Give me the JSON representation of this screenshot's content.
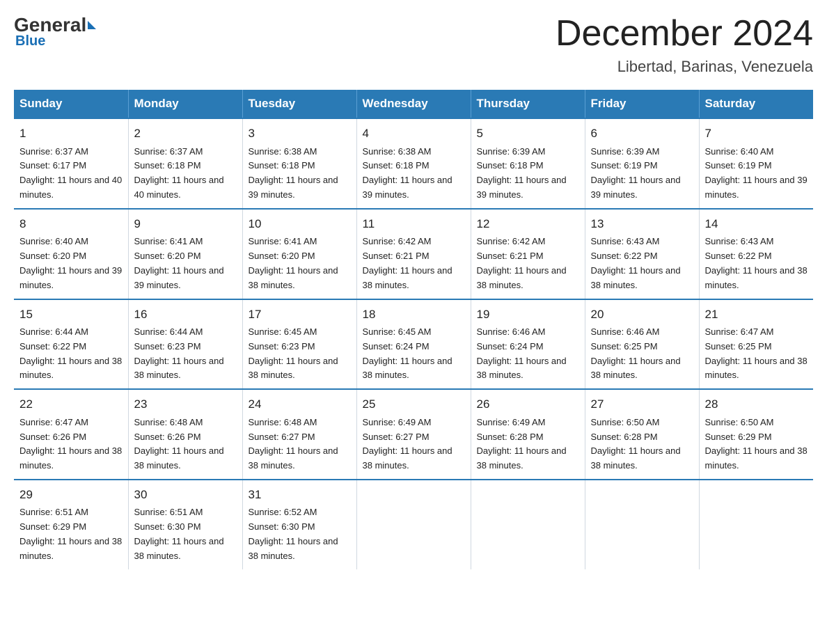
{
  "logo": {
    "general": "General",
    "blue": "Blue"
  },
  "title": "December 2024",
  "subtitle": "Libertad, Barinas, Venezuela",
  "days_of_week": [
    "Sunday",
    "Monday",
    "Tuesday",
    "Wednesday",
    "Thursday",
    "Friday",
    "Saturday"
  ],
  "weeks": [
    [
      {
        "day": "1",
        "sunrise": "6:37 AM",
        "sunset": "6:17 PM",
        "daylight": "11 hours and 40 minutes."
      },
      {
        "day": "2",
        "sunrise": "6:37 AM",
        "sunset": "6:18 PM",
        "daylight": "11 hours and 40 minutes."
      },
      {
        "day": "3",
        "sunrise": "6:38 AM",
        "sunset": "6:18 PM",
        "daylight": "11 hours and 39 minutes."
      },
      {
        "day": "4",
        "sunrise": "6:38 AM",
        "sunset": "6:18 PM",
        "daylight": "11 hours and 39 minutes."
      },
      {
        "day": "5",
        "sunrise": "6:39 AM",
        "sunset": "6:18 PM",
        "daylight": "11 hours and 39 minutes."
      },
      {
        "day": "6",
        "sunrise": "6:39 AM",
        "sunset": "6:19 PM",
        "daylight": "11 hours and 39 minutes."
      },
      {
        "day": "7",
        "sunrise": "6:40 AM",
        "sunset": "6:19 PM",
        "daylight": "11 hours and 39 minutes."
      }
    ],
    [
      {
        "day": "8",
        "sunrise": "6:40 AM",
        "sunset": "6:20 PM",
        "daylight": "11 hours and 39 minutes."
      },
      {
        "day": "9",
        "sunrise": "6:41 AM",
        "sunset": "6:20 PM",
        "daylight": "11 hours and 39 minutes."
      },
      {
        "day": "10",
        "sunrise": "6:41 AM",
        "sunset": "6:20 PM",
        "daylight": "11 hours and 38 minutes."
      },
      {
        "day": "11",
        "sunrise": "6:42 AM",
        "sunset": "6:21 PM",
        "daylight": "11 hours and 38 minutes."
      },
      {
        "day": "12",
        "sunrise": "6:42 AM",
        "sunset": "6:21 PM",
        "daylight": "11 hours and 38 minutes."
      },
      {
        "day": "13",
        "sunrise": "6:43 AM",
        "sunset": "6:22 PM",
        "daylight": "11 hours and 38 minutes."
      },
      {
        "day": "14",
        "sunrise": "6:43 AM",
        "sunset": "6:22 PM",
        "daylight": "11 hours and 38 minutes."
      }
    ],
    [
      {
        "day": "15",
        "sunrise": "6:44 AM",
        "sunset": "6:22 PM",
        "daylight": "11 hours and 38 minutes."
      },
      {
        "day": "16",
        "sunrise": "6:44 AM",
        "sunset": "6:23 PM",
        "daylight": "11 hours and 38 minutes."
      },
      {
        "day": "17",
        "sunrise": "6:45 AM",
        "sunset": "6:23 PM",
        "daylight": "11 hours and 38 minutes."
      },
      {
        "day": "18",
        "sunrise": "6:45 AM",
        "sunset": "6:24 PM",
        "daylight": "11 hours and 38 minutes."
      },
      {
        "day": "19",
        "sunrise": "6:46 AM",
        "sunset": "6:24 PM",
        "daylight": "11 hours and 38 minutes."
      },
      {
        "day": "20",
        "sunrise": "6:46 AM",
        "sunset": "6:25 PM",
        "daylight": "11 hours and 38 minutes."
      },
      {
        "day": "21",
        "sunrise": "6:47 AM",
        "sunset": "6:25 PM",
        "daylight": "11 hours and 38 minutes."
      }
    ],
    [
      {
        "day": "22",
        "sunrise": "6:47 AM",
        "sunset": "6:26 PM",
        "daylight": "11 hours and 38 minutes."
      },
      {
        "day": "23",
        "sunrise": "6:48 AM",
        "sunset": "6:26 PM",
        "daylight": "11 hours and 38 minutes."
      },
      {
        "day": "24",
        "sunrise": "6:48 AM",
        "sunset": "6:27 PM",
        "daylight": "11 hours and 38 minutes."
      },
      {
        "day": "25",
        "sunrise": "6:49 AM",
        "sunset": "6:27 PM",
        "daylight": "11 hours and 38 minutes."
      },
      {
        "day": "26",
        "sunrise": "6:49 AM",
        "sunset": "6:28 PM",
        "daylight": "11 hours and 38 minutes."
      },
      {
        "day": "27",
        "sunrise": "6:50 AM",
        "sunset": "6:28 PM",
        "daylight": "11 hours and 38 minutes."
      },
      {
        "day": "28",
        "sunrise": "6:50 AM",
        "sunset": "6:29 PM",
        "daylight": "11 hours and 38 minutes."
      }
    ],
    [
      {
        "day": "29",
        "sunrise": "6:51 AM",
        "sunset": "6:29 PM",
        "daylight": "11 hours and 38 minutes."
      },
      {
        "day": "30",
        "sunrise": "6:51 AM",
        "sunset": "6:30 PM",
        "daylight": "11 hours and 38 minutes."
      },
      {
        "day": "31",
        "sunrise": "6:52 AM",
        "sunset": "6:30 PM",
        "daylight": "11 hours and 38 minutes."
      },
      null,
      null,
      null,
      null
    ]
  ]
}
